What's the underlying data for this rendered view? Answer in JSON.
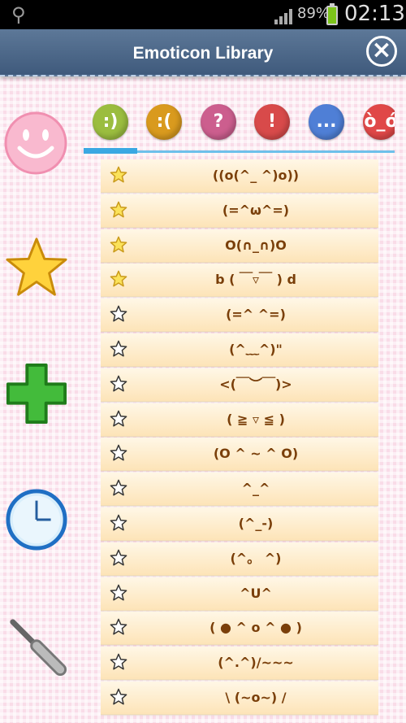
{
  "status_bar": {
    "battery_percent": "89%",
    "time": "02:13"
  },
  "header": {
    "title": "Emoticon Library",
    "close_icon": "close-circle-icon"
  },
  "sidebar": {
    "icons": [
      "smiley-icon",
      "star-icon",
      "plus-icon",
      "clock-icon",
      "screwdriver-icon"
    ]
  },
  "tabs": [
    {
      "label": ":)",
      "color": "#9bbd3f"
    },
    {
      "label": ":(",
      "color": "#d99a1e"
    },
    {
      "label": "?",
      "color": "#cc5e8e"
    },
    {
      "label": "!",
      "color": "#d84a4a"
    },
    {
      "label": "...",
      "color": "#4f7fd6"
    },
    {
      "label": "",
      "color": "#e04848"
    }
  ],
  "emoticons": [
    {
      "text": "((o(^_ ^)o))",
      "favorite": true
    },
    {
      "text": "(=^ω^=)",
      "favorite": true
    },
    {
      "text": "O(∩_∩)O",
      "favorite": true
    },
    {
      "text": "b ( ￣▿￣ ) d",
      "favorite": true
    },
    {
      "text": "(=^ ^=)",
      "favorite": false
    },
    {
      "text": "(^﹏^)\"",
      "favorite": false
    },
    {
      "text": "<(￣︶￣)>",
      "favorite": false
    },
    {
      "text": "( ≧ ▿ ≦ )",
      "favorite": false
    },
    {
      "text": "(O ^ ~ ^ O)",
      "favorite": false
    },
    {
      "text": "^_^",
      "favorite": false
    },
    {
      "text": "(^_-)",
      "favorite": false
    },
    {
      "text": "(^。 ^)",
      "favorite": false
    },
    {
      "text": "^U^",
      "favorite": false
    },
    {
      "text": "( ● ^ o ^ ● )",
      "favorite": false
    },
    {
      "text": "(^.^)/~~~",
      "favorite": false
    },
    {
      "text": "\\ (~o~) /",
      "favorite": false
    }
  ]
}
